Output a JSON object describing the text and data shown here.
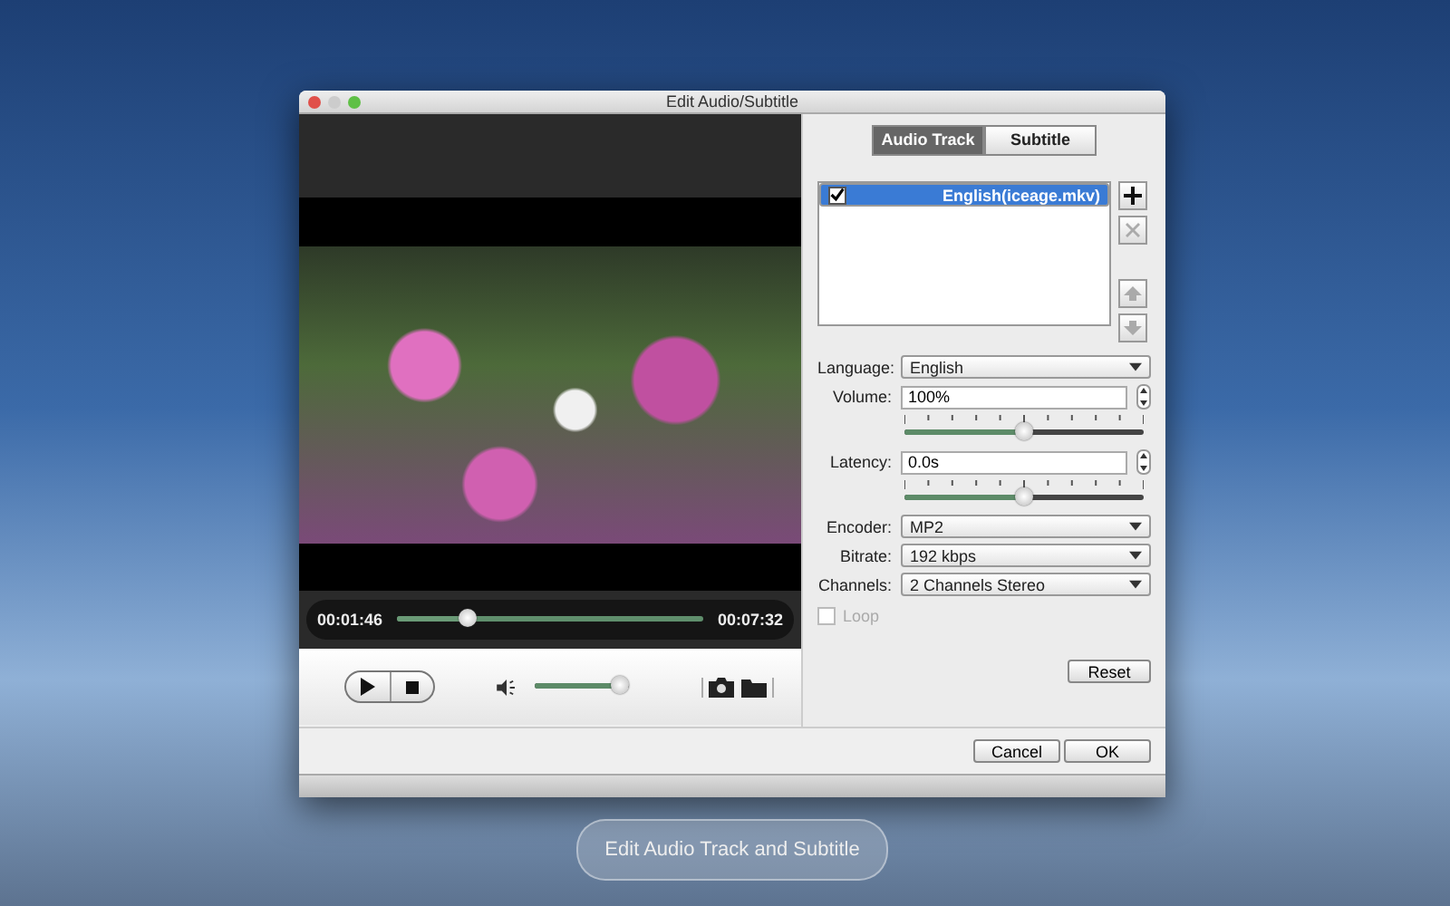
{
  "window": {
    "title": "Edit Audio/Subtitle"
  },
  "player": {
    "current_time": "00:01:46",
    "total_time": "00:07:32",
    "progress": {
      "level": 0.23
    },
    "volume": {
      "level": 0.9
    }
  },
  "tabs": [
    {
      "label": "Audio Track",
      "selected": true
    },
    {
      "label": "Subtitle",
      "selected": false
    }
  ],
  "tracks": [
    {
      "name": "English(iceage.mkv)",
      "checked": true,
      "selected": true
    }
  ],
  "track_buttons": [
    {
      "kind": "add",
      "disabled": false
    },
    {
      "kind": "remove",
      "disabled": true
    },
    {
      "kind": "up",
      "disabled": true
    },
    {
      "kind": "down",
      "disabled": true
    }
  ],
  "settings": [
    {
      "kind": "select",
      "label": "Language:",
      "value": "English"
    },
    {
      "kind": "spin",
      "label": "Volume:",
      "value": "100%"
    },
    {
      "kind": "slider",
      "level": 0.5
    },
    {
      "kind": "spin",
      "label": "Latency:",
      "value": "0.0s"
    },
    {
      "kind": "slider",
      "level": 0.5
    },
    {
      "kind": "select",
      "label": "Encoder:",
      "value": "MP2"
    },
    {
      "kind": "select",
      "label": "Bitrate:",
      "value": "192 kbps"
    },
    {
      "kind": "select",
      "label": "Channels:",
      "value": "2 Channels Stereo"
    }
  ],
  "loop": {
    "label": "Loop",
    "checked": false,
    "disabled": true
  },
  "reset_button": "Reset",
  "buttons": [
    "Cancel",
    "OK"
  ],
  "caption": "Edit Audio Track and Subtitle"
}
